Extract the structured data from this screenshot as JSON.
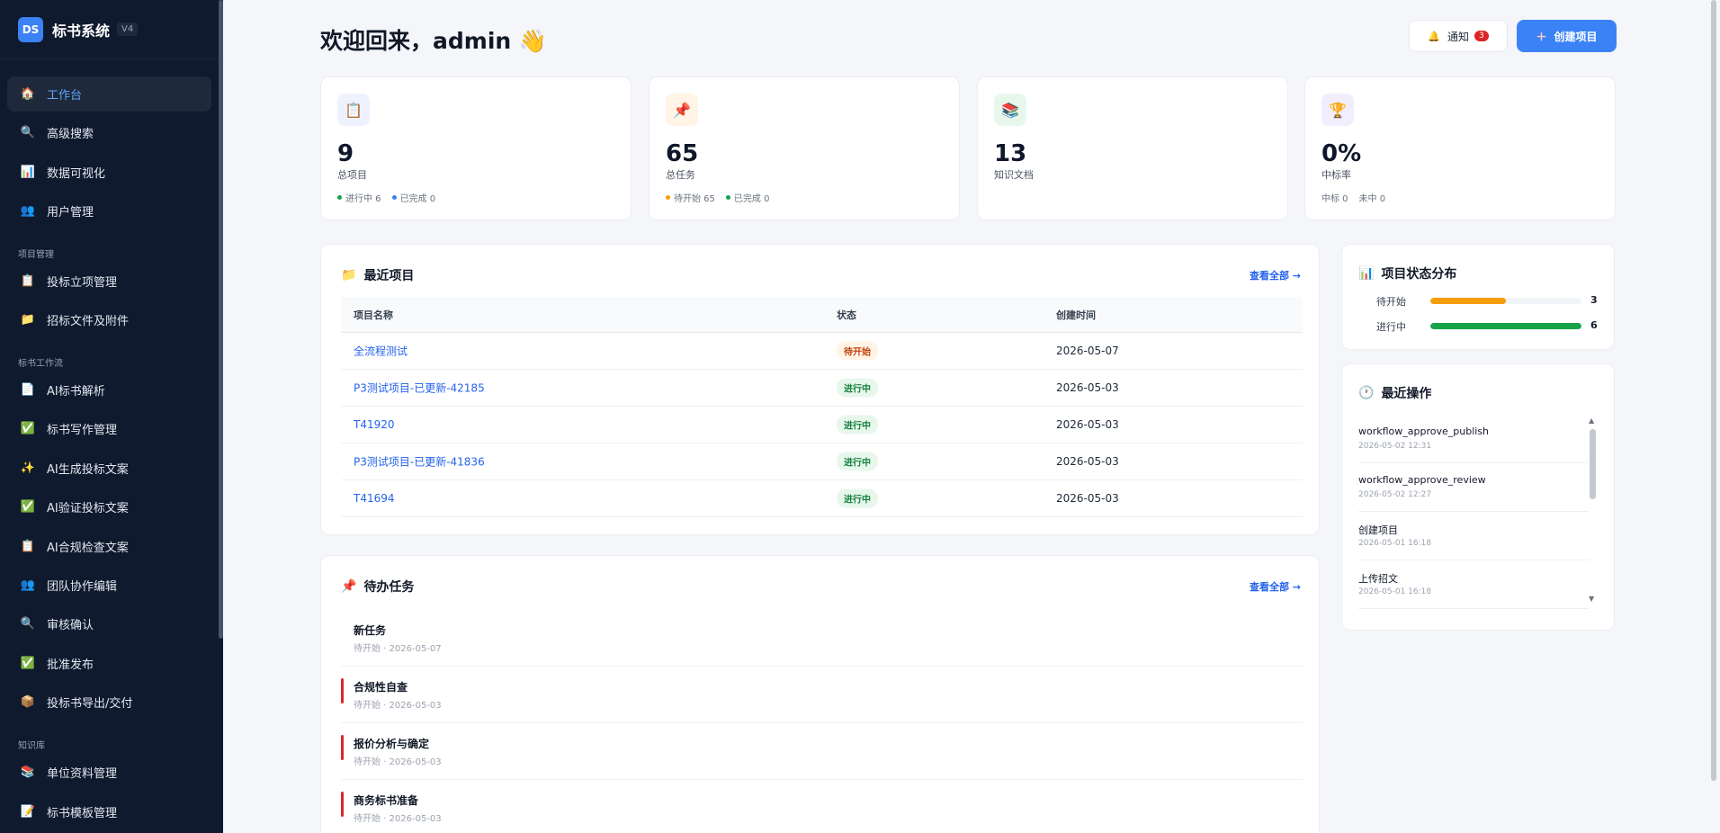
{
  "app": {
    "logo": "DS",
    "name": "标书系统",
    "version": "V4"
  },
  "sidebar": {
    "items_top": [
      {
        "label": "工作台",
        "icon": "🏠",
        "name": "home-icon",
        "active": true
      },
      {
        "label": "高级搜索",
        "icon": "🔍",
        "name": "search-icon"
      },
      {
        "label": "数据可视化",
        "icon": "📊",
        "name": "chart-icon"
      },
      {
        "label": "用户管理",
        "icon": "👥",
        "name": "users-icon"
      }
    ],
    "section_project": "项目管理",
    "items_project": [
      {
        "label": "投标立项管理",
        "icon": "📋",
        "name": "clipboard-icon"
      },
      {
        "label": "招标文件及附件",
        "icon": "📁",
        "name": "folder-icon"
      }
    ],
    "section_workflow": "标书工作流",
    "items_workflow": [
      {
        "label": "AI标书解析",
        "icon": "📄",
        "name": "document-icon"
      },
      {
        "label": "标书写作管理",
        "icon": "✅",
        "name": "check-icon"
      },
      {
        "label": "AI生成投标文案",
        "icon": "✨",
        "name": "sparkles-icon"
      },
      {
        "label": "AI验证投标文案",
        "icon": "✅",
        "name": "check-icon"
      },
      {
        "label": "AI合规检查文案",
        "icon": "📋",
        "name": "clipboard-icon"
      },
      {
        "label": "团队协作编辑",
        "icon": "👥",
        "name": "users-icon"
      },
      {
        "label": "审核确认",
        "icon": "🔍",
        "name": "search-icon"
      },
      {
        "label": "批准发布",
        "icon": "✅",
        "name": "check-icon"
      },
      {
        "label": "投标书导出/交付",
        "icon": "📦",
        "name": "package-icon"
      }
    ],
    "section_kb": "知识库",
    "items_kb": [
      {
        "label": "单位资料管理",
        "icon": "📚",
        "name": "books-icon"
      },
      {
        "label": "标书模板管理",
        "icon": "📝",
        "name": "memo-icon"
      }
    ]
  },
  "header": {
    "welcome": "欢迎回来，admin 👋",
    "notify_label": "通知",
    "notify_icon": "🔔",
    "notify_count": "3",
    "create_label": "创建项目",
    "create_icon": "＋"
  },
  "stats": [
    {
      "icon": "📋",
      "icon_name": "clipboard-icon",
      "bg": "#eef2ff",
      "value": "9",
      "label": "总项目",
      "subs": [
        {
          "text": "进行中 6",
          "color": "#16a34a"
        },
        {
          "text": "已完成 0",
          "color": "#3b82f6"
        }
      ]
    },
    {
      "icon": "📌",
      "icon_name": "pin-icon",
      "bg": "#fff4e5",
      "value": "65",
      "label": "总任务",
      "subs": [
        {
          "text": "待开始 65",
          "color": "#f59e0b"
        },
        {
          "text": "已完成 0",
          "color": "#16a34a"
        }
      ]
    },
    {
      "icon": "📚",
      "icon_name": "books-icon",
      "bg": "#e7f7ec",
      "value": "13",
      "label": "知识文档",
      "subs": []
    },
    {
      "icon": "🏆",
      "icon_name": "trophy-icon",
      "bg": "#f3eefe",
      "value": "0%",
      "label": "中标率",
      "subs": [
        {
          "text": "中标 0",
          "color": ""
        },
        {
          "text": "未中 0",
          "color": ""
        }
      ]
    }
  ],
  "recent_projects": {
    "title": "最近项目",
    "icon": "📁",
    "view_all": "查看全部 →",
    "columns": [
      "项目名称",
      "状态",
      "创建时间"
    ],
    "rows": [
      {
        "name": "全流程测试",
        "status": "待开始",
        "kind": "pending",
        "date": "2026-05-07"
      },
      {
        "name": "P3测试项目-已更新-42185",
        "status": "进行中",
        "kind": "progress",
        "date": "2026-05-03"
      },
      {
        "name": "T41920",
        "status": "进行中",
        "kind": "progress",
        "date": "2026-05-03"
      },
      {
        "name": "P3测试项目-已更新-41836",
        "status": "进行中",
        "kind": "progress",
        "date": "2026-05-03"
      },
      {
        "name": "T41694",
        "status": "进行中",
        "kind": "progress",
        "date": "2026-05-03"
      }
    ]
  },
  "todo": {
    "title": "待办任务",
    "icon": "📌",
    "view_all": "查看全部 →",
    "items": [
      {
        "title": "新任务",
        "sub": "待开始 · 2026-05-07",
        "urgent": false
      },
      {
        "title": "合规性自查",
        "sub": "待开始 · 2026-05-03",
        "urgent": true
      },
      {
        "title": "报价分析与确定",
        "sub": "待开始 · 2026-05-03",
        "urgent": true
      },
      {
        "title": "商务标书准备",
        "sub": "待开始 · 2026-05-03",
        "urgent": true
      }
    ]
  },
  "status_dist": {
    "title": "项目状态分布",
    "icon": "📊",
    "rows": [
      {
        "label": "待开始",
        "count": "3",
        "fraction": 0.5,
        "color": "#f59e0b"
      },
      {
        "label": "进行中",
        "count": "6",
        "fraction": 1.0,
        "color": "#16a34a"
      }
    ]
  },
  "recent_ops": {
    "title": "最近操作",
    "icon": "🕐",
    "items": [
      {
        "title": "workflow_approve_publish",
        "time": "2026-05-02 12:31"
      },
      {
        "title": "workflow_approve_review",
        "time": "2026-05-02 12:27"
      },
      {
        "title": "创建项目",
        "time": "2026-05-01 16:18"
      },
      {
        "title": "上传招文",
        "time": "2026-05-01 16:18"
      }
    ]
  }
}
